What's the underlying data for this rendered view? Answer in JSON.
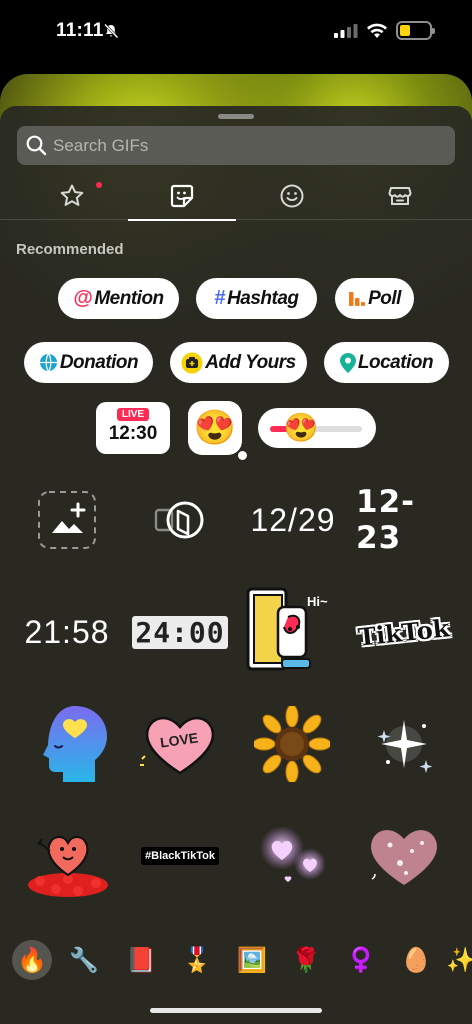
{
  "status_bar": {
    "time": "11:11"
  },
  "search": {
    "placeholder": "Search GIFs"
  },
  "tabs": [
    {
      "name": "favorites",
      "icon": "star-icon",
      "active": false
    },
    {
      "name": "stickers",
      "icon": "sticker-icon",
      "active": true
    },
    {
      "name": "emoji",
      "icon": "smiley-icon",
      "active": false
    },
    {
      "name": "shop",
      "icon": "shop-icon",
      "active": false
    }
  ],
  "section": {
    "title": "Recommended"
  },
  "chips": {
    "mention": {
      "label": "Mention",
      "glyph": "@"
    },
    "hashtag": {
      "label": "Hashtag",
      "glyph": "#"
    },
    "poll": {
      "label": "Poll"
    },
    "donation": {
      "label": "Donation"
    },
    "add_yours": {
      "label": "Add Yours"
    },
    "location": {
      "label": "Location"
    }
  },
  "live": {
    "badge": "LIVE",
    "time": "12:30"
  },
  "emoji_question": {
    "emoji": "😍"
  },
  "emoji_slider": {
    "emoji": "😍",
    "level": 0.3
  },
  "stickers": {
    "date1": "12/29",
    "date2": "12-23",
    "time1": "21:58",
    "time2": "24:00",
    "tiktok_text": "TikTok",
    "hi_text": "Hi~",
    "love_text": "LOVE",
    "hashtag_black": "#BlackTikTok"
  },
  "colors": {
    "accent": "#fe2c55",
    "sheet": "#2a2a26",
    "chip_bg": "#ffffff"
  },
  "categories": [
    "fire-icon",
    "wrench-icon",
    "book-icon",
    "badge-icon",
    "dad-icon",
    "rose-icon",
    "female-symbol-icon",
    "egg-icon",
    "sparkle-icon"
  ]
}
